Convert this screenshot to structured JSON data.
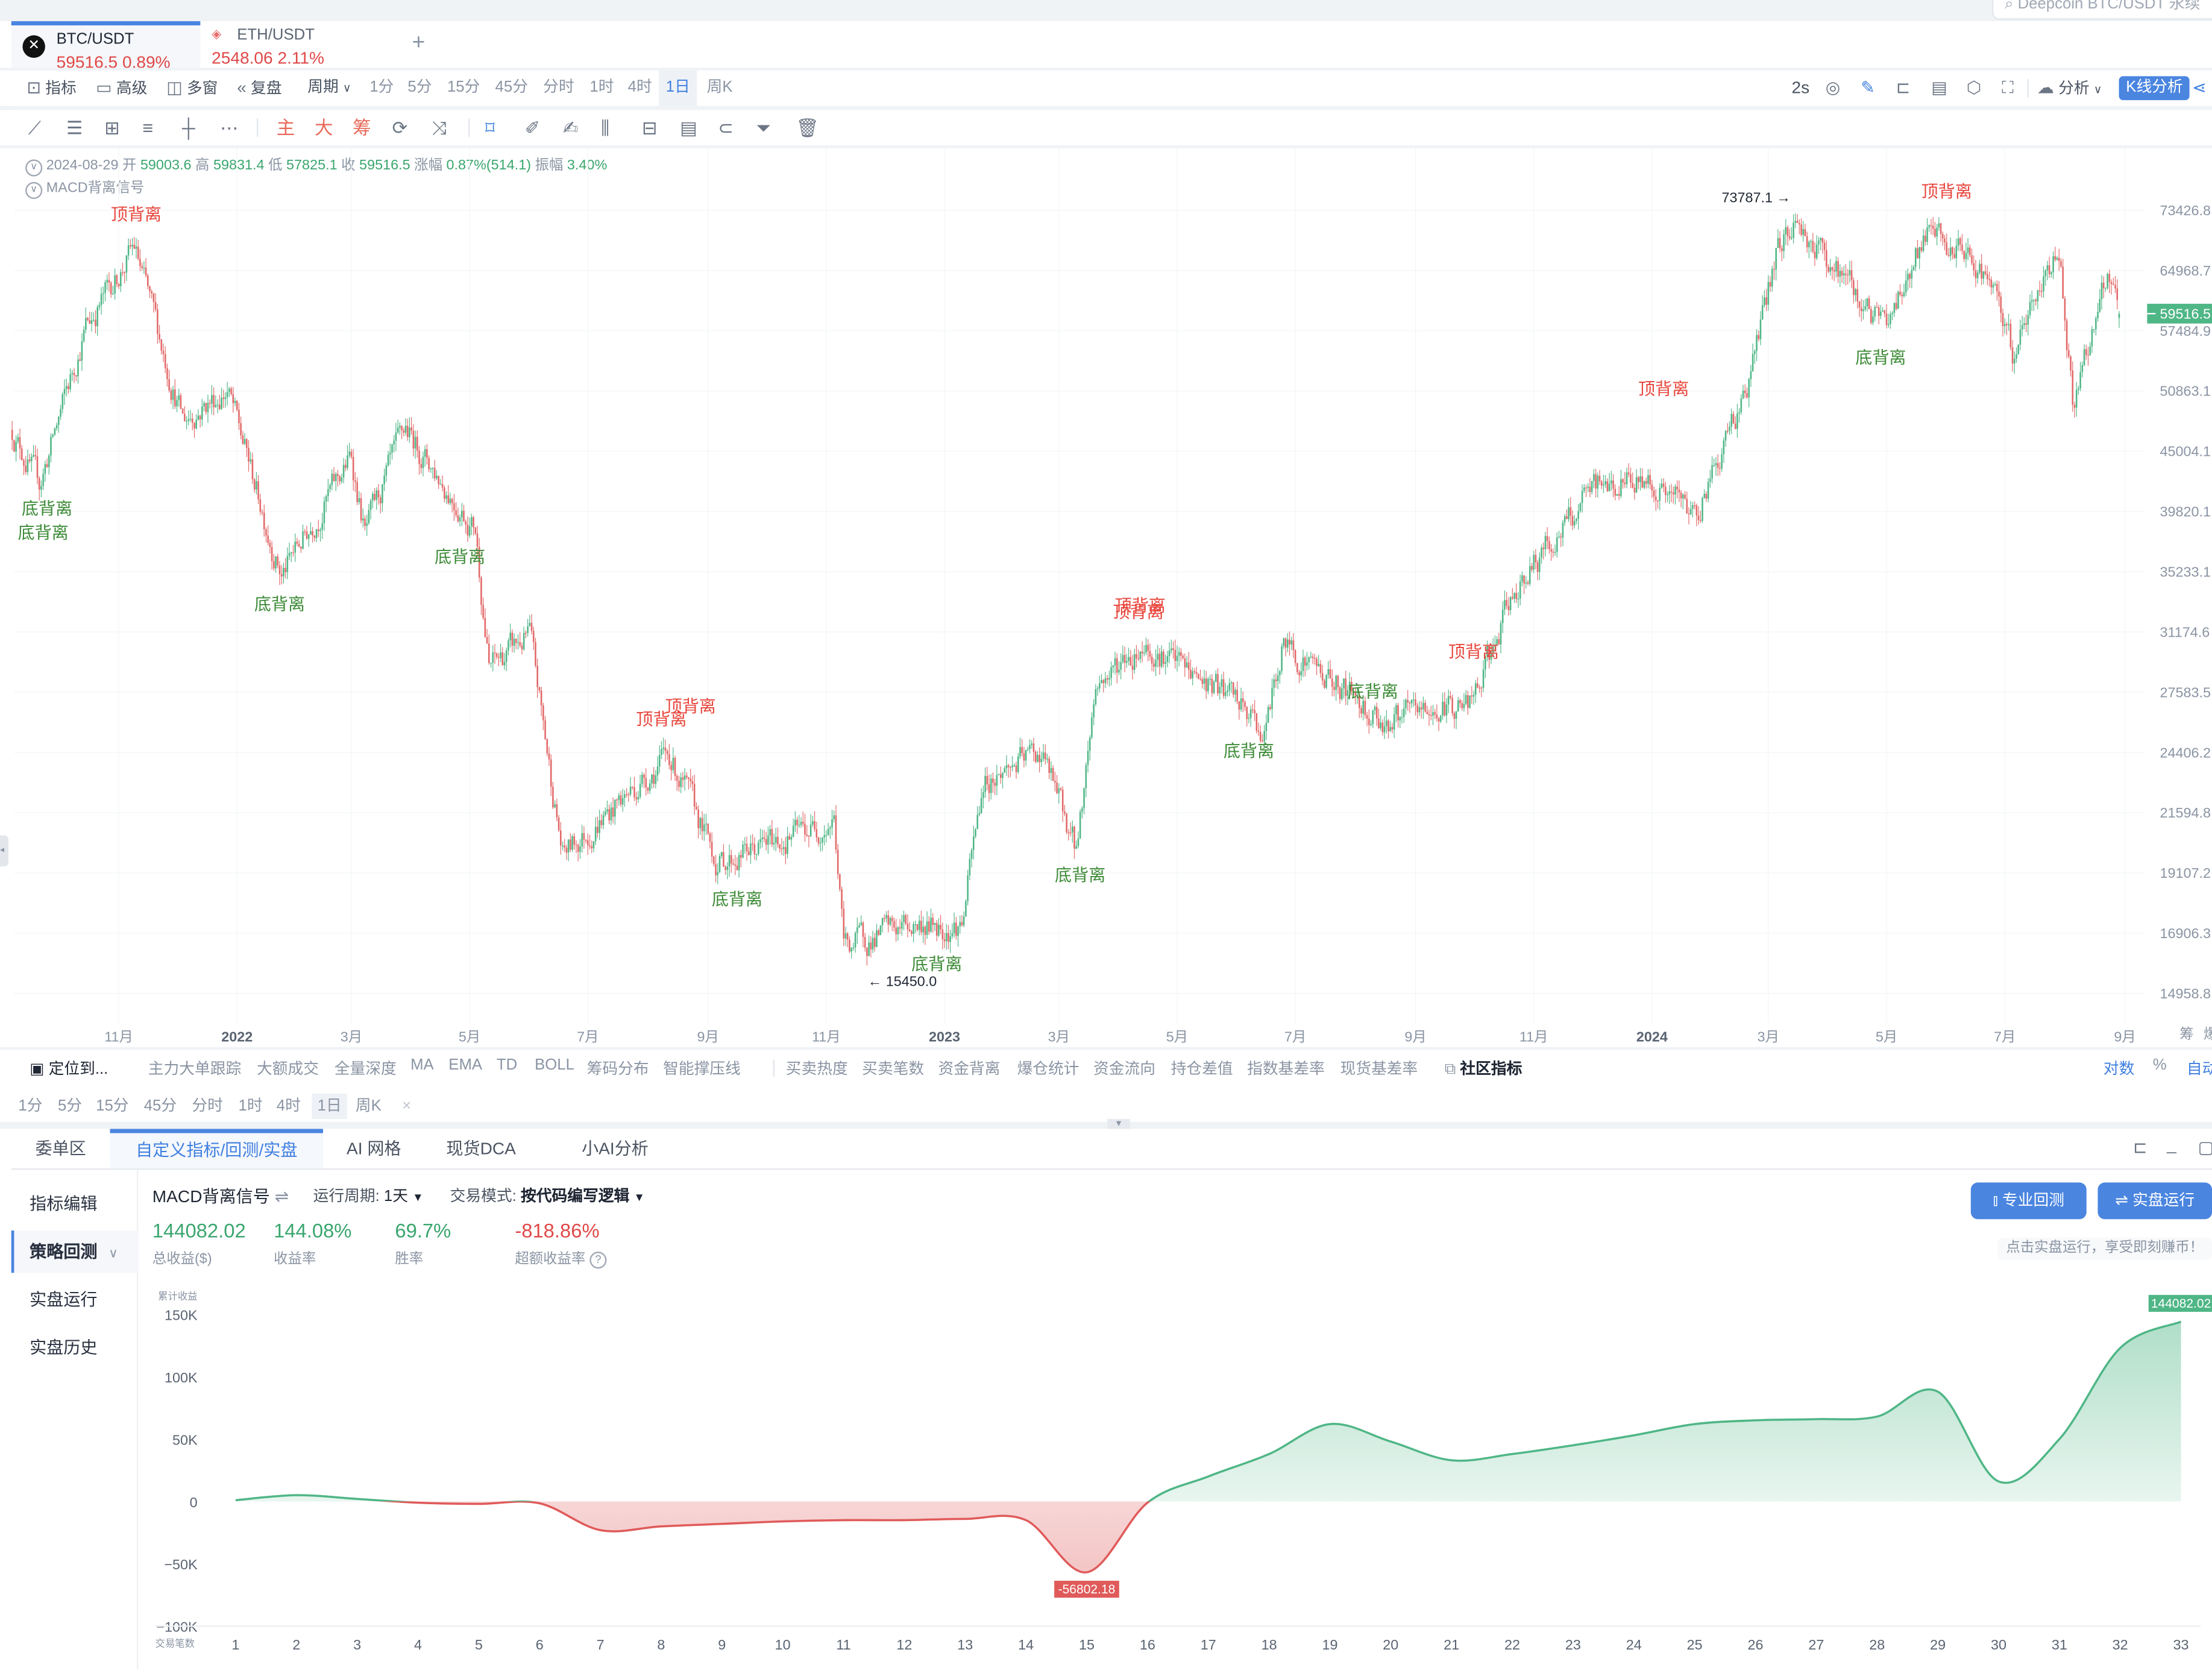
{
  "search": {
    "placeholder": "Deepcoin BTC/USDT 永续"
  },
  "tabs": [
    {
      "symbol": "BTC/USDT",
      "price": "59516.5",
      "change": "0.89%",
      "icon": "okx-logo-icon"
    },
    {
      "symbol": "ETH/USDT",
      "price": "2548.06",
      "change": "2.11%",
      "icon": "eth-diamond-icon"
    }
  ],
  "add_tab": "+",
  "toolbar": {
    "indicator": "指标",
    "advanced": "高级",
    "multi_window": "多窗",
    "replay": "复盘",
    "period": "周期",
    "periods": [
      "1分",
      "5分",
      "15分",
      "45分",
      "分时",
      "1时",
      "4时",
      "1日",
      "周K"
    ],
    "active_period": "1日",
    "refresh": "2s",
    "analysis": "分析",
    "kline_analysis": "K线分析"
  },
  "draw_tools": {
    "text_tools": [
      "主",
      "大",
      "筹"
    ],
    "icons": [
      "trend-line-icon",
      "parallel-lines-icon",
      "rectangle-icon",
      "horizontal-lines-icon",
      "crosshair-icon",
      "more-icon",
      "cycle-icon",
      "ruler-compare-icon",
      "bookmark-icon",
      "pencil-icon",
      "brush-icon",
      "candle-pattern-icon",
      "lock-icon",
      "note-icon",
      "magnet-icon",
      "filter-icon",
      "trash-icon"
    ]
  },
  "ohlc": {
    "date": "2024-08-29",
    "open_label": "开",
    "open": "59003.6",
    "high_label": "高",
    "high": "59831.4",
    "low_label": "低",
    "low": "57825.1",
    "close_label": "收",
    "close": "59516.5",
    "change_label": "涨幅",
    "change": "0.87%(514.1)",
    "amplitude_label": "振幅",
    "amplitude": "3.40%"
  },
  "indicator_name": "MACD背离信号",
  "price_chart": {
    "type": "candlestick",
    "scale": "log",
    "up_color": "#4fb686",
    "down_color": "#e26868",
    "price_axis": [
      "73426.8",
      "64968.7",
      "57484.9",
      "50863.1",
      "45004.1",
      "39820.1",
      "35233.1",
      "31174.6",
      "27583.5",
      "24406.2",
      "21594.8",
      "19107.2",
      "16906.3",
      "14958.8"
    ],
    "current_price": "59516.5",
    "time_axis": [
      {
        "label": "11月",
        "date": "2021-11-01"
      },
      {
        "label": "2022",
        "date": "2022-01-01",
        "year": true
      },
      {
        "label": "3月",
        "date": "2022-03-01"
      },
      {
        "label": "5月",
        "date": "2022-05-01"
      },
      {
        "label": "7月",
        "date": "2022-07-01"
      },
      {
        "label": "9月",
        "date": "2022-09-01"
      },
      {
        "label": "11月",
        "date": "2022-11-01"
      },
      {
        "label": "2023",
        "date": "2023-01-01",
        "year": true
      },
      {
        "label": "3月",
        "date": "2023-03-01"
      },
      {
        "label": "5月",
        "date": "2023-05-01"
      },
      {
        "label": "7月",
        "date": "2023-07-01"
      },
      {
        "label": "9月",
        "date": "2023-09-01"
      },
      {
        "label": "11月",
        "date": "2023-11-01"
      },
      {
        "label": "2024",
        "date": "2024-01-01",
        "year": true
      },
      {
        "label": "3月",
        "date": "2024-03-01"
      },
      {
        "label": "5月",
        "date": "2024-05-01"
      },
      {
        "label": "7月",
        "date": "2024-07-01"
      },
      {
        "label": "9月",
        "date": "2024-09-01"
      }
    ],
    "price_path": [
      {
        "date": "2021-09-07",
        "price": 47000
      },
      {
        "date": "2021-09-21",
        "price": 42000
      },
      {
        "date": "2021-10-15",
        "price": 58000
      },
      {
        "date": "2021-11-09",
        "price": 68000
      },
      {
        "date": "2021-12-04",
        "price": 48000
      },
      {
        "date": "2021-12-27",
        "price": 51000
      },
      {
        "date": "2022-01-24",
        "price": 35000
      },
      {
        "date": "2022-03-01",
        "price": 44500
      },
      {
        "date": "2022-03-08",
        "price": 38000
      },
      {
        "date": "2022-03-29",
        "price": 47000
      },
      {
        "date": "2022-05-04",
        "price": 38500
      },
      {
        "date": "2022-05-11",
        "price": 29000
      },
      {
        "date": "2022-06-01",
        "price": 31000
      },
      {
        "date": "2022-06-18",
        "price": 19800
      },
      {
        "date": "2022-08-12",
        "price": 24300
      },
      {
        "date": "2022-09-06",
        "price": 19500
      },
      {
        "date": "2022-11-05",
        "price": 21300
      },
      {
        "date": "2022-11-10",
        "price": 16500
      },
      {
        "date": "2022-12-15",
        "price": 17200
      },
      {
        "date": "2023-01-10",
        "price": 17200
      },
      {
        "date": "2023-01-21",
        "price": 23000
      },
      {
        "date": "2023-02-20",
        "price": 24500
      },
      {
        "date": "2023-03-10",
        "price": 20000
      },
      {
        "date": "2023-03-20",
        "price": 28000
      },
      {
        "date": "2023-04-14",
        "price": 30500
      },
      {
        "date": "2023-06-01",
        "price": 27000
      },
      {
        "date": "2023-06-15",
        "price": 25300
      },
      {
        "date": "2023-06-25",
        "price": 30500
      },
      {
        "date": "2023-08-17",
        "price": 26000
      },
      {
        "date": "2023-10-01",
        "price": 27000
      },
      {
        "date": "2023-10-24",
        "price": 34500
      },
      {
        "date": "2023-12-05",
        "price": 42000
      },
      {
        "date": "2023-12-30",
        "price": 42500
      },
      {
        "date": "2024-01-23",
        "price": 39500
      },
      {
        "date": "2024-02-20",
        "price": 52000
      },
      {
        "date": "2024-03-05",
        "price": 67000
      },
      {
        "date": "2024-03-14",
        "price": 72000
      },
      {
        "date": "2024-04-30",
        "price": 58000
      },
      {
        "date": "2024-05-21",
        "price": 70000
      },
      {
        "date": "2024-06-20",
        "price": 65000
      },
      {
        "date": "2024-07-05",
        "price": 55000
      },
      {
        "date": "2024-07-29",
        "price": 68500
      },
      {
        "date": "2024-08-05",
        "price": 50000
      },
      {
        "date": "2024-08-23",
        "price": 64000
      },
      {
        "date": "2024-08-29",
        "price": 59516.5
      }
    ],
    "signals": [
      {
        "text": "顶背离",
        "kind": "top",
        "date": "2021-11-10",
        "price": 72000
      },
      {
        "text": "底背离",
        "kind": "bottom",
        "date": "2021-09-25",
        "price": 39600
      },
      {
        "text": "底背离",
        "kind": "bottom",
        "date": "2021-09-23",
        "price": 37700
      },
      {
        "text": "底背离",
        "kind": "bottom",
        "date": "2022-01-23",
        "price": 32600
      },
      {
        "text": "底背离",
        "kind": "bottom",
        "date": "2022-04-26",
        "price": 35900
      },
      {
        "text": "顶背离",
        "kind": "top",
        "date": "2022-08-08",
        "price": 25800
      },
      {
        "text": "顶背离",
        "kind": "top",
        "date": "2022-08-23",
        "price": 26500
      },
      {
        "text": "底背离",
        "kind": "bottom",
        "date": "2022-09-16",
        "price": 17900
      },
      {
        "text": "底背离",
        "kind": "bottom",
        "date": "2022-12-28",
        "price": 15700
      },
      {
        "text": "底背离",
        "kind": "bottom",
        "date": "2023-03-12",
        "price": 18800
      },
      {
        "text": "顶背离",
        "kind": "top",
        "date": "2023-04-11",
        "price": 32100
      },
      {
        "text": "顶背离",
        "kind": "top",
        "date": "2023-04-12",
        "price": 32500
      },
      {
        "text": "底背离",
        "kind": "bottom",
        "date": "2023-06-07",
        "price": 24200
      },
      {
        "text": "底背离",
        "kind": "bottom",
        "date": "2023-08-10",
        "price": 27300
      },
      {
        "text": "顶背离",
        "kind": "top",
        "date": "2023-10-01",
        "price": 29600
      },
      {
        "text": "顶背离",
        "kind": "top",
        "date": "2024-01-07",
        "price": 50500
      },
      {
        "text": "底背离",
        "kind": "bottom",
        "date": "2024-04-28",
        "price": 53800
      },
      {
        "text": "顶背离",
        "kind": "top",
        "date": "2024-06-01",
        "price": 75400
      }
    ],
    "high_marker": {
      "text": "73787.1 →",
      "date": "2024-03-14",
      "price": 73787.1
    },
    "low_marker": {
      "text": "← 15450.0",
      "date": "2022-11-21",
      "price": 15450.0
    },
    "top_color": "#e8463c",
    "bottom_color": "#3d8b37"
  },
  "indicator_bar": {
    "locate": "定位到...",
    "items_a": [
      "主力大单跟踪",
      "大额成交",
      "全量深度",
      "MA",
      "EMA",
      "TD",
      "BOLL",
      "筹码分布",
      "智能撑压线"
    ],
    "items_b": [
      "买卖热度",
      "买卖笔数",
      "资金背离",
      "爆仓统计",
      "资金流向",
      "持仓差值",
      "指数基差率",
      "现货基差率"
    ],
    "community": "社区指标",
    "log": "对数",
    "percent": "%",
    "auto": "自动",
    "axis_side": [
      "筹",
      "爆"
    ]
  },
  "timeframes": [
    "1分",
    "5分",
    "15分",
    "45分",
    "分时",
    "1时",
    "4时",
    "1日",
    "周K"
  ],
  "active_timeframe": "1日",
  "close_timeframes": "×",
  "bottom_tabs": [
    "委单区",
    "自定义指标/回测/实盘",
    "AI 网格",
    "现货DCA",
    "小AI分析"
  ],
  "active_bottom_tab": "自定义指标/回测/实盘",
  "sidebar": [
    "指标编辑",
    "策略回测",
    "实盘运行",
    "实盘历史"
  ],
  "active_sidebar": "策略回测",
  "strategy": {
    "name": "MACD背离信号",
    "period_label": "运行周期:",
    "period_value": "1天",
    "mode_label": "交易模式:",
    "mode_value": "按代码编写逻辑",
    "stats": [
      {
        "value": "144082.02",
        "label": "总收益($)",
        "color": "#3aa66e"
      },
      {
        "value": "144.08%",
        "label": "收益率",
        "color": "#3aa66e"
      },
      {
        "value": "69.7%",
        "label": "胜率",
        "color": "#3aa66e"
      },
      {
        "value": "-818.86%",
        "label": "超额收益率",
        "color": "#e04848"
      }
    ],
    "pro_backtest": "专业回测",
    "live_run": "实盘运行",
    "note": "点击实盘运行，享受即刻赚币！"
  },
  "chart_data": {
    "type": "area",
    "ylabel": "累计收益",
    "xlabel": "交易笔数",
    "ylim": [
      -100000,
      150000
    ],
    "yticks": [
      "150K",
      "100K",
      "50K",
      "0",
      "−50K",
      "−100K"
    ],
    "ytick_values": [
      150000,
      100000,
      50000,
      0,
      -50000,
      -100000
    ],
    "x": [
      1,
      2,
      3,
      4,
      5,
      6,
      7,
      8,
      9,
      10,
      11,
      12,
      13,
      14,
      15,
      16,
      17,
      18,
      19,
      20,
      21,
      22,
      23,
      24,
      25,
      26,
      27,
      28,
      29,
      30,
      31,
      32,
      33
    ],
    "values": [
      1000,
      5000,
      2000,
      -1000,
      -2000,
      -1500,
      -23000,
      -20000,
      -18000,
      -16000,
      -15000,
      -15000,
      -14000,
      -15000,
      -56802.18,
      -1000,
      20000,
      38000,
      62000,
      48000,
      33000,
      38000,
      45000,
      53000,
      62000,
      65000,
      66000,
      68000,
      88000,
      16000,
      50000,
      123000,
      144082.02
    ],
    "positive_color": "#4fb686",
    "negative_color": "#e05a5a",
    "max_label": "144082.02",
    "min_label": "-56802.18"
  }
}
